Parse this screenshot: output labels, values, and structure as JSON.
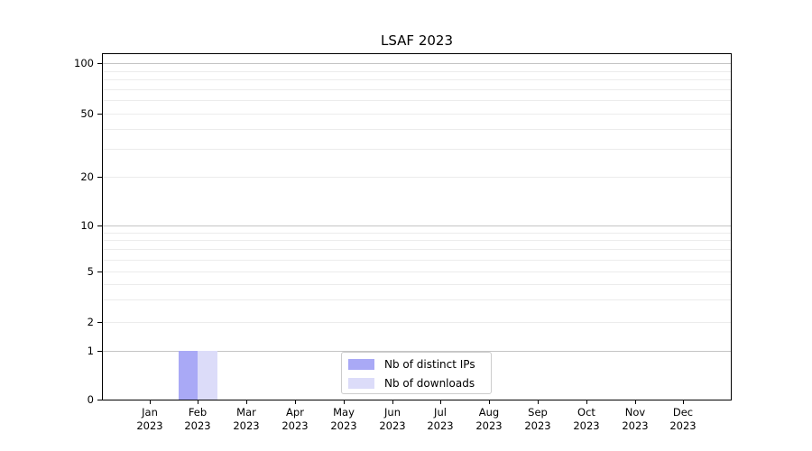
{
  "title": "LSAF 2023",
  "colors": {
    "distinct_ips": "#a9a9f6",
    "downloads": "#dcdcf9",
    "grid_minor": "#ececec",
    "grid_decade": "#c4c4c4",
    "axis": "#000000",
    "legend_border": "#cccccc",
    "background": "#ffffff",
    "text": "#000000"
  },
  "legend": {
    "items": [
      {
        "label": "Nb of distinct IPs",
        "color_key": "distinct_ips"
      },
      {
        "label": "Nb of downloads",
        "color_key": "downloads"
      }
    ]
  },
  "axis": {
    "x_months": [
      "Jan",
      "Feb",
      "Mar",
      "Apr",
      "May",
      "Jun",
      "Jul",
      "Aug",
      "Sep",
      "Oct",
      "Nov",
      "Dec"
    ],
    "x_year": "2023",
    "y_tick_labels": [
      "0",
      "1",
      "2",
      "5",
      "10",
      "20",
      "50",
      "100"
    ]
  },
  "chart_data": {
    "type": "bar",
    "title": "LSAF 2023",
    "categories": [
      "Jan 2023",
      "Feb 2023",
      "Mar 2023",
      "Apr 2023",
      "May 2023",
      "Jun 2023",
      "Jul 2023",
      "Aug 2023",
      "Sep 2023",
      "Oct 2023",
      "Nov 2023",
      "Dec 2023"
    ],
    "series": [
      {
        "name": "Nb of distinct IPs",
        "color_key": "distinct_ips",
        "values": [
          0,
          1,
          0,
          0,
          0,
          0,
          0,
          0,
          0,
          0,
          0,
          0
        ]
      },
      {
        "name": "Nb of downloads",
        "color_key": "downloads",
        "values": [
          0,
          1,
          0,
          0,
          0,
          0,
          0,
          0,
          0,
          0,
          0,
          0
        ]
      }
    ],
    "xlabel": "",
    "ylabel": "",
    "yscale": "log-like (linear 0-1, logarithmic above 1)",
    "yticks": [
      0,
      1,
      2,
      5,
      10,
      20,
      50,
      100
    ],
    "y_gridlines_minor": [
      2,
      3,
      4,
      5,
      6,
      7,
      8,
      9,
      20,
      30,
      40,
      50,
      60,
      70,
      80,
      90
    ],
    "y_gridlines_decade": [
      1,
      10,
      100
    ],
    "ylim": [
      0,
      113
    ],
    "grid": "horizontal only",
    "legend_position": "lower center inside plot"
  }
}
